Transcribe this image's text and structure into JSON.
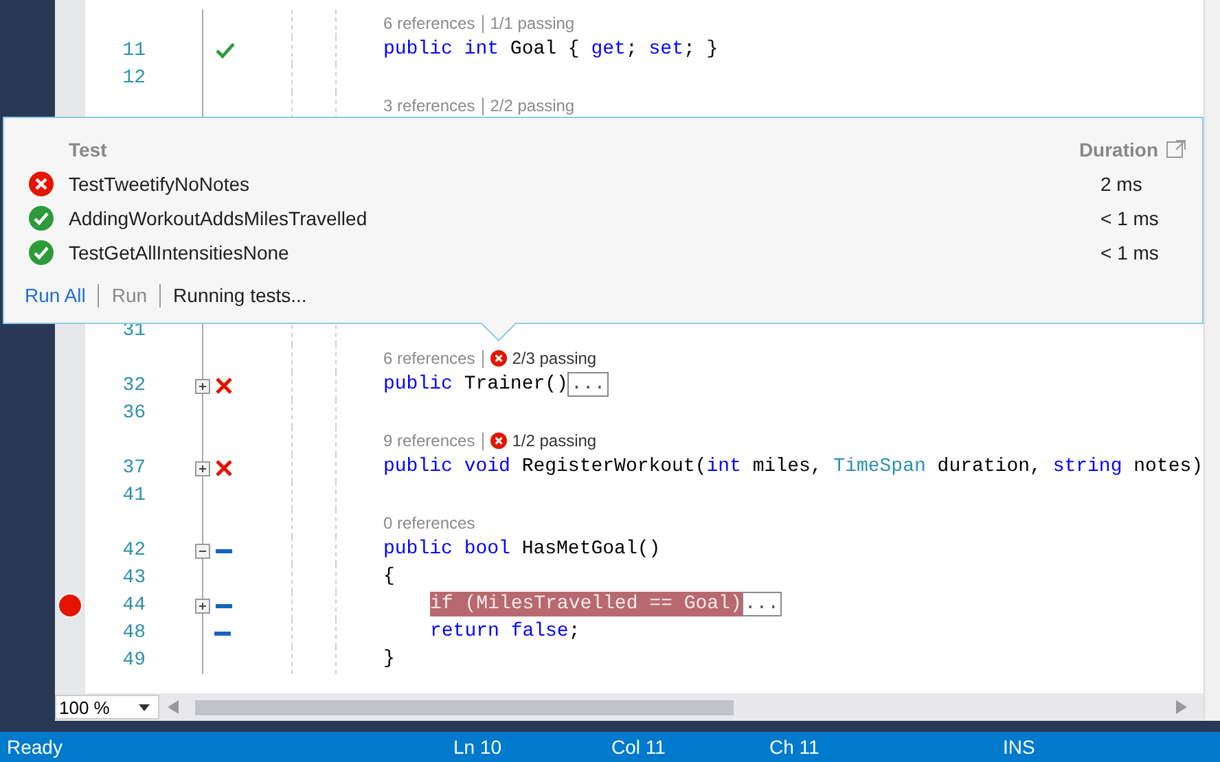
{
  "editor": {
    "lines": [
      {
        "kind": "lens",
        "references": "6 references",
        "tests": "1/1 passing"
      },
      {
        "kind": "code",
        "number": "11",
        "tested": true,
        "passed": true,
        "tokens": [
          {
            "kind": "keyword",
            "text": "public "
          },
          {
            "kind": "keyword",
            "text": "int "
          },
          {
            "kind": "plain",
            "text": "Goal { "
          },
          {
            "kind": "keyword",
            "text": "get"
          },
          {
            "kind": "plain",
            "text": "; "
          },
          {
            "kind": "keyword",
            "text": "set"
          },
          {
            "kind": "plain",
            "text": "; }"
          }
        ]
      },
      {
        "kind": "code",
        "number": "12"
      },
      {
        "kind": "lens",
        "references": "3 references",
        "tests": "2/2 passing"
      },
      {
        "kind": "gap"
      },
      {
        "kind": "code",
        "number": "31"
      },
      {
        "kind": "lens",
        "references": "6 references",
        "tests": "2/3 passing",
        "failed": true
      },
      {
        "kind": "code",
        "number": "32",
        "tested": true,
        "passed": false,
        "expanded": false,
        "tokens": [
          {
            "kind": "keyword",
            "text": "public "
          },
          {
            "kind": "plain",
            "text": "Trainer()"
          },
          {
            "kind": "collapsed",
            "text": "..."
          }
        ]
      },
      {
        "kind": "code",
        "number": "36"
      },
      {
        "kind": "lens",
        "references": "9 references",
        "tests": "1/2 passing",
        "failed": true
      },
      {
        "kind": "code",
        "number": "37",
        "tested": true,
        "passed": false,
        "expanded": false,
        "tokens": [
          {
            "kind": "keyword",
            "text": "public "
          },
          {
            "kind": "keyword",
            "text": "void "
          },
          {
            "kind": "plain",
            "text": "RegisterWorkout("
          },
          {
            "kind": "keyword",
            "text": "int "
          },
          {
            "kind": "plain",
            "text": "miles, "
          },
          {
            "kind": "type",
            "text": "TimeSpan "
          },
          {
            "kind": "plain",
            "text": "duration, "
          },
          {
            "kind": "keyword",
            "text": "string "
          },
          {
            "kind": "plain",
            "text": "notes)"
          }
        ]
      },
      {
        "kind": "code",
        "number": "41"
      },
      {
        "kind": "lens",
        "references": "0 references"
      },
      {
        "kind": "code",
        "number": "42",
        "tested": false,
        "expanded": true,
        "tokens": [
          {
            "kind": "keyword",
            "text": "public "
          },
          {
            "kind": "keyword",
            "text": "bool "
          },
          {
            "kind": "plain",
            "text": "HasMetGoal()"
          }
        ]
      },
      {
        "kind": "code",
        "number": "43",
        "tokens": [
          {
            "kind": "plain",
            "text": "{"
          }
        ]
      },
      {
        "kind": "code",
        "number": "44",
        "tested": false,
        "expanded": false,
        "breakpoint": true,
        "highlighted": true,
        "indented": true,
        "tokens": [
          {
            "kind": "keyword",
            "text": "if "
          },
          {
            "kind": "plain",
            "text": "(MilesTravelled == Goal)"
          },
          {
            "kind": "collapsed",
            "text": "..."
          }
        ]
      },
      {
        "kind": "code",
        "number": "48",
        "tested": false,
        "indented": true,
        "tokens": [
          {
            "kind": "keyword",
            "text": "return "
          },
          {
            "kind": "keyword",
            "text": "false"
          },
          {
            "kind": "plain",
            "text": ";"
          }
        ]
      },
      {
        "kind": "code",
        "number": "49",
        "tokens": [
          {
            "kind": "plain",
            "text": "}"
          }
        ]
      }
    ],
    "zoom": "100 %"
  },
  "popup": {
    "columns": [
      "Test",
      "Duration"
    ],
    "tests": [
      {
        "passed": false,
        "name": "TestTweetifyNoNotes",
        "duration": "2 ms"
      },
      {
        "passed": true,
        "name": "AddingWorkoutAddsMilesTravelled",
        "duration": "< 1 ms"
      },
      {
        "passed": true,
        "name": "TestGetAllIntensitiesNone",
        "duration": "< 1 ms"
      }
    ],
    "actions": [
      {
        "label": "Run All",
        "disabled": false
      },
      {
        "label": "Run",
        "disabled": true
      }
    ],
    "message": "Running tests..."
  },
  "status_bar": [
    "Ready",
    "Ln 10",
    "Col 11",
    "Ch 11",
    "INS"
  ]
}
